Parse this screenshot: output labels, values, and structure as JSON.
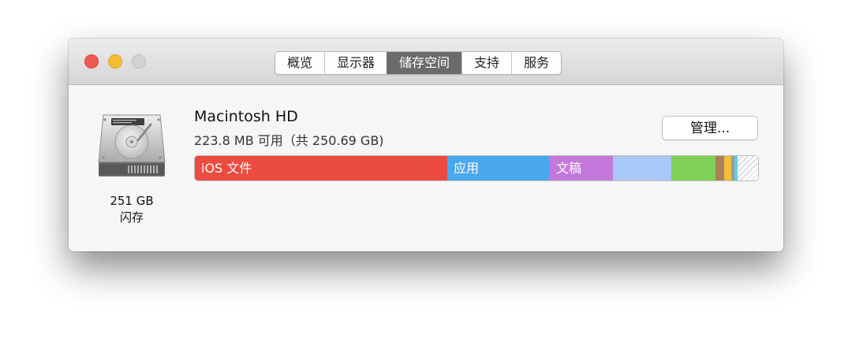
{
  "window": {
    "tabs": [
      {
        "label": "概览",
        "active": false
      },
      {
        "label": "显示器",
        "active": false
      },
      {
        "label": "储存空间",
        "active": true
      },
      {
        "label": "支持",
        "active": false
      },
      {
        "label": "服务",
        "active": false
      }
    ]
  },
  "disk": {
    "icon": "hard-drive-icon",
    "capacity": "251 GB",
    "type": "闪存"
  },
  "drive": {
    "name": "Macintosh HD",
    "availability": "223.8 MB 可用（共 250.69 GB)",
    "manage_label": "管理..."
  },
  "storage_bar": {
    "segments": [
      {
        "label": "iOS 文件",
        "share": 0.448,
        "color": "#ec4c3f"
      },
      {
        "label": "应用",
        "share": 0.182,
        "color": "#4aa8ee"
      },
      {
        "label": "文稿",
        "share": 0.112,
        "color": "#c379db"
      },
      {
        "label": "",
        "share": 0.104,
        "color": "#a8c8f7"
      },
      {
        "label": "",
        "share": 0.078,
        "color": "#7fd054"
      },
      {
        "label": "",
        "share": 0.015,
        "color": "#a98256"
      },
      {
        "label": "",
        "share": 0.012,
        "color": "#f2be3c"
      },
      {
        "label": "",
        "share": 0.005,
        "color": "#9a9a9a"
      },
      {
        "label": "",
        "share": 0.006,
        "color": "#57d3e6"
      }
    ],
    "free_pattern": "striped"
  }
}
